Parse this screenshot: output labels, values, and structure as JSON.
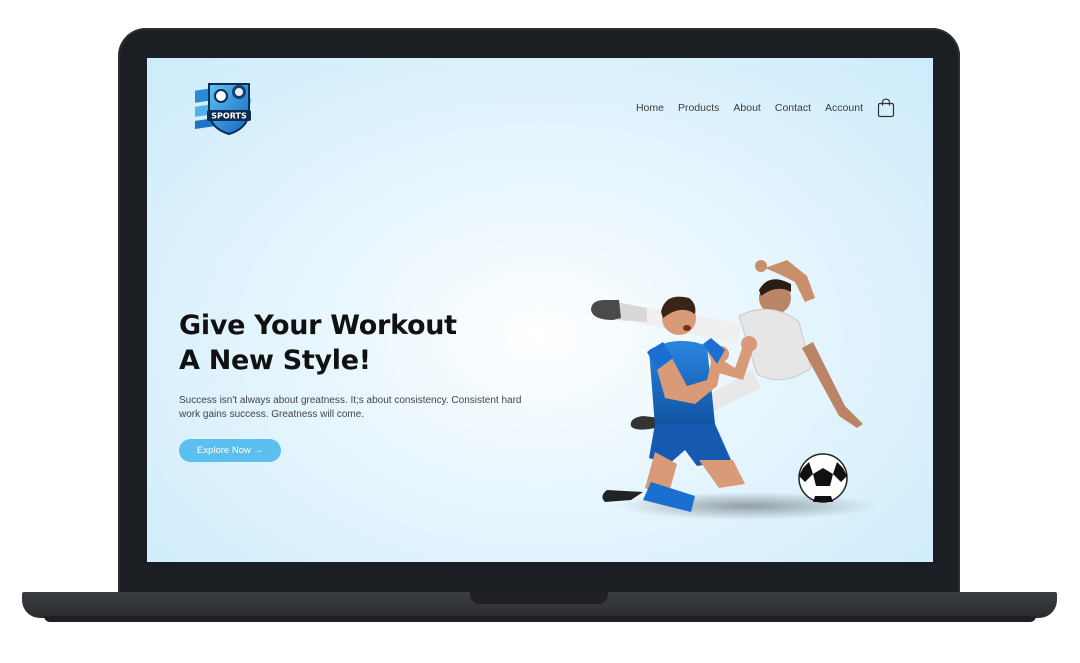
{
  "nav": {
    "items": [
      "Home",
      "Products",
      "About",
      "Contact",
      "Account"
    ],
    "cart_icon": "shopping-bag-icon"
  },
  "logo": {
    "text": "SPORTS",
    "icon": "sports-shield-logo"
  },
  "hero": {
    "title_line1": "Give Your Workout",
    "title_line2": "A New Style!",
    "subtitle": "Success isn't always about greatness. It;s about consistency. Consistent hard work gains success. Greatness will come.",
    "cta_label": "Explore Now →"
  },
  "colors": {
    "accent": "#5bbff0",
    "background": "#cdebfb",
    "text": "#111111",
    "jersey_blue": "#1a6fd1"
  }
}
